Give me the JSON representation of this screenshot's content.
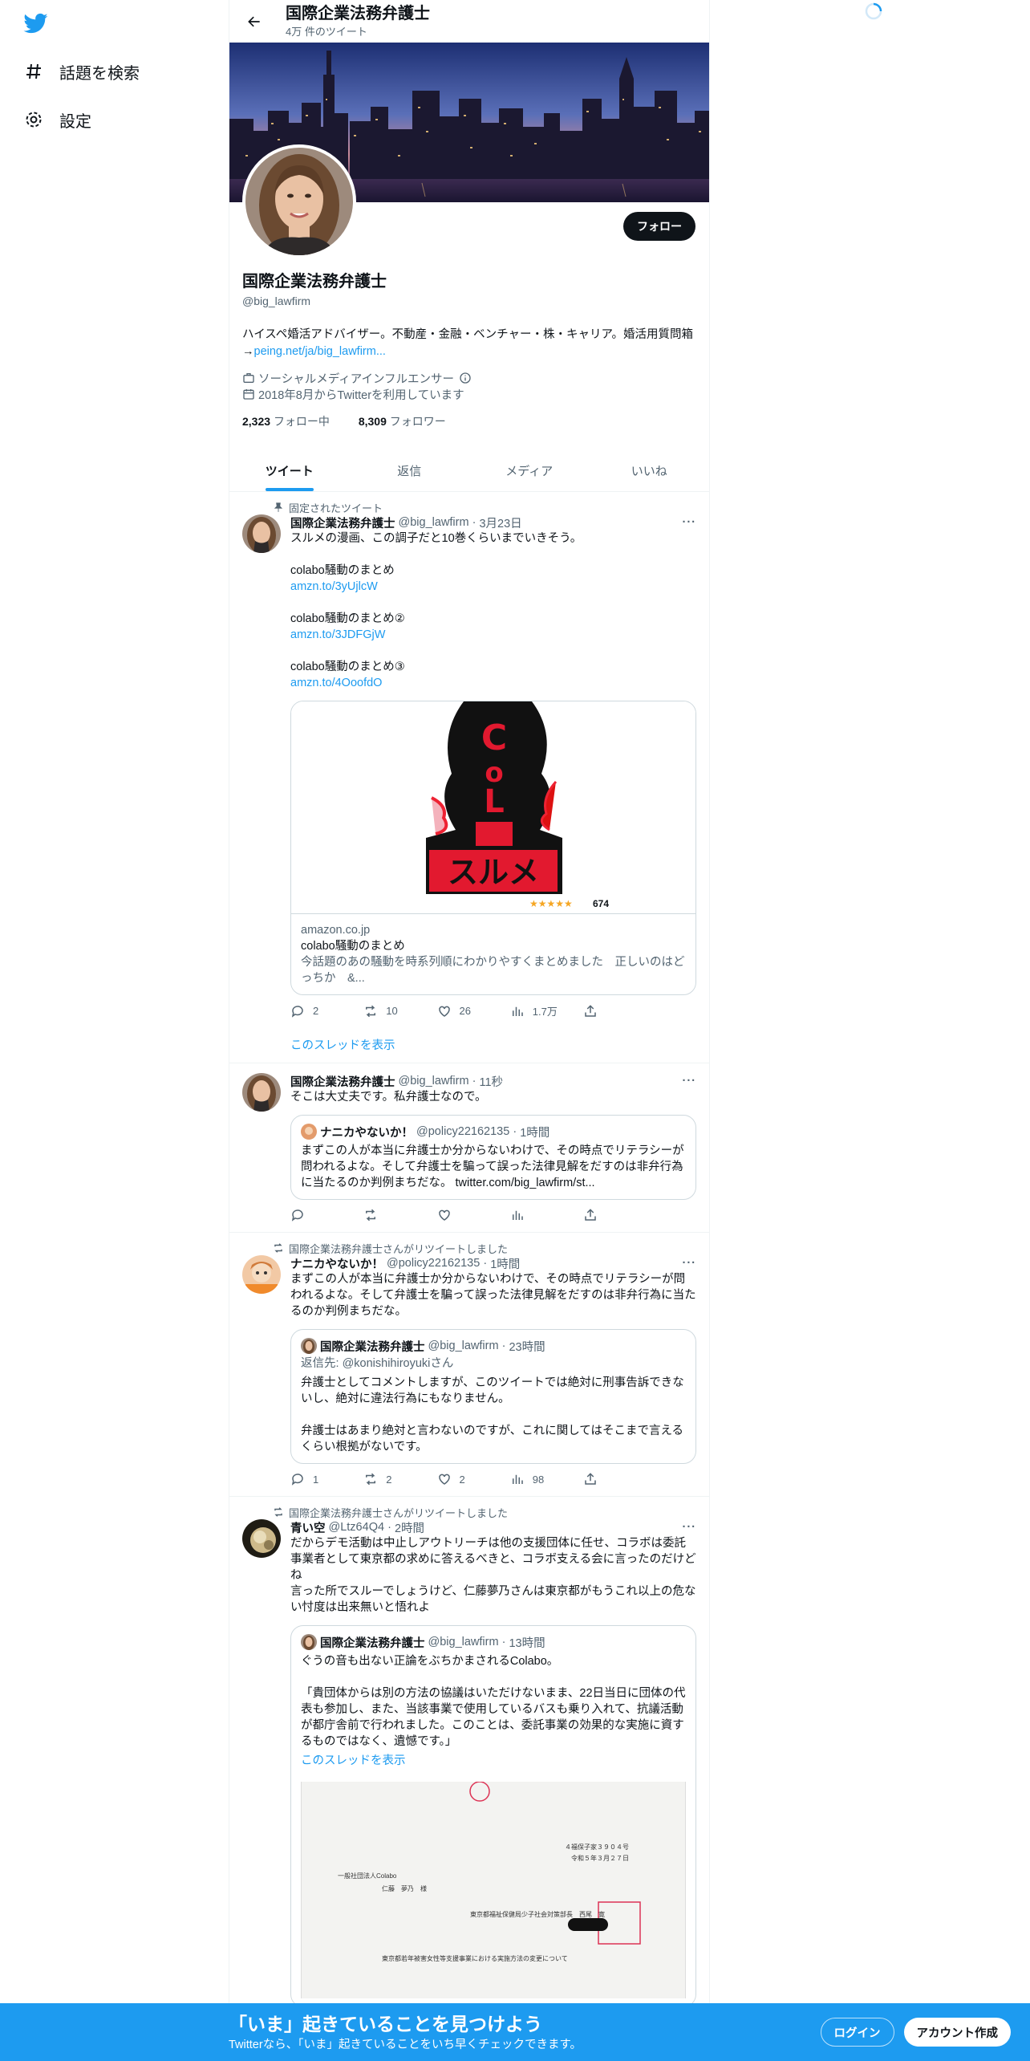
{
  "nav": {
    "items": [
      {
        "label": "話題を検索",
        "icon": "hashtag-icon"
      },
      {
        "label": "設定",
        "icon": "gear-icon"
      }
    ]
  },
  "header": {
    "name": "国際企業法務弁護士",
    "tweet_count": "4万 件のツイート"
  },
  "profile": {
    "follow_label": "フォロー",
    "name": "国際企業法務弁護士",
    "handle": "@big_lawfirm",
    "bio_text": "ハイスペ婚活アドバイザー。不動産・金融・ベンチャー・株・キャリア。婚活用質問箱→",
    "bio_link": "peing.net/ja/big_lawfirm...",
    "category": "ソーシャルメディアインフルエンサー",
    "joined": "2018年8月からTwitterを利用しています",
    "following_count": "2,323",
    "following_label": "フォロー中",
    "followers_count": "8,309",
    "followers_label": "フォロワー"
  },
  "tabs": [
    "ツイート",
    "返信",
    "メディア",
    "いいね"
  ],
  "tweets": {
    "t1": {
      "context": "固定されたツイート",
      "name": "国際企業法務弁護士",
      "handle": "@big_lawfirm",
      "time": "3月23日",
      "text": "スルメの漫画、この調子だと10巻くらいまでいきそう。",
      "line2": "colabo騒動のまとめ",
      "link2": "amzn.to/3yUjlcW",
      "line3": "colabo騒動のまとめ②",
      "link3": "amzn.to/3JDFGjW",
      "line4": "colabo騒動のまとめ③",
      "link4": "amzn.to/4OoofdO",
      "card_rating": "674",
      "card_domain": "amazon.co.jp",
      "card_title": "colabo騒動のまとめ",
      "card_desc": "今話題のあの騒動を時系列順にわかりやすくまとめました　正しいのはどっちか　&...",
      "replies": "2",
      "retweets": "10",
      "likes": "26",
      "views": "1.7万",
      "thread_link": "このスレッドを表示"
    },
    "t2": {
      "name": "国際企業法務弁護士",
      "handle": "@big_lawfirm",
      "time": "11秒",
      "text": "そこは大丈夫です。私弁護士なので。",
      "q_name": "ナニカやないか！",
      "q_handle": "@policy22162135",
      "q_time": "1時間",
      "q_text": "まずこの人が本当に弁護士か分からないわけで、その時点でリテラシーが問われるよな。そして弁護士を騙って誤った法律見解をだすのは非弁行為に当たるのか判例まちだな。",
      "q_link": "twitter.com/big_lawfirm/st..."
    },
    "t3": {
      "context": "国際企業法務弁護士さんがリツイートしました",
      "name": "ナニカやないか！",
      "handle": "@policy22162135",
      "time": "1時間",
      "text": "まずこの人が本当に弁護士か分からないわけで、その時点でリテラシーが問われるよな。そして弁護士を騙って誤った法律見解をだすのは非弁行為に当たるのか判例まちだな。",
      "q_name": "国際企業法務弁護士",
      "q_handle": "@big_lawfirm",
      "q_time": "23時間",
      "q_reply_prefix": "返信先: ",
      "q_reply_to": "@konishihiroyukiさん",
      "q_text": "弁護士としてコメントしますが、このツイートでは絶対に刑事告訴できないし、絶対に違法行為にもなりません。\n\n弁護士はあまり絶対と言わないのですが、これに関してはそこまで言えるくらい根拠がないです。",
      "replies": "1",
      "retweets": "2",
      "likes": "2",
      "views": "98"
    },
    "t4": {
      "context": "国際企業法務弁護士さんがリツイートしました",
      "name": "青い空",
      "handle": "@Ltz64Q4",
      "time": "2時間",
      "text": "だからデモ活動は中止しアウトリーチは他の支援団体に任せ、コラボは委託事業者として東京都の求めに答えるべきと、コラボ支える会に言ったのだけどね\n言った所でスルーでしょうけど、仁藤夢乃さんは東京都がもうこれ以上の危ない忖度は出来無いと悟れよ",
      "q_name": "国際企業法務弁護士",
      "q_handle": "@big_lawfirm",
      "q_time": "13時間",
      "q_text": "ぐうの音も出ない正論をぶちかまされるColabo。\n\n「貴団体からは別の方法の協議はいただけないまま、22日当日に団体の代表も参加し、また、当該事業で使用しているバスも乗り入れて、抗議活動が都庁舎前で行われました。このことは、委託事業の効果的な実施に資するものではなく、遺憾です。」",
      "q_thread_link": "このスレッドを表示",
      "doc_line1": "４福保子家３９０４号",
      "doc_line2": "令和５年３月２７日",
      "doc_line3": "一般社団法人Colabo",
      "doc_line4": "仁藤　夢乃　様",
      "doc_line5": "東京都福祉保健局少子社会対策部長　西尾　寛",
      "doc_line6": "東京都若年被害女性等支援事業における実施方法の変更について"
    }
  },
  "bottom": {
    "headline": "「いま」起きていることを見つけよう",
    "sub": "Twitterなら、「いま」起きていることをいち早くチェックできます。",
    "login": "ログイン",
    "signup": "アカウント作成"
  },
  "colors": {
    "accent": "#1d9bf0",
    "text": "#0f1419",
    "muted": "#536471"
  }
}
